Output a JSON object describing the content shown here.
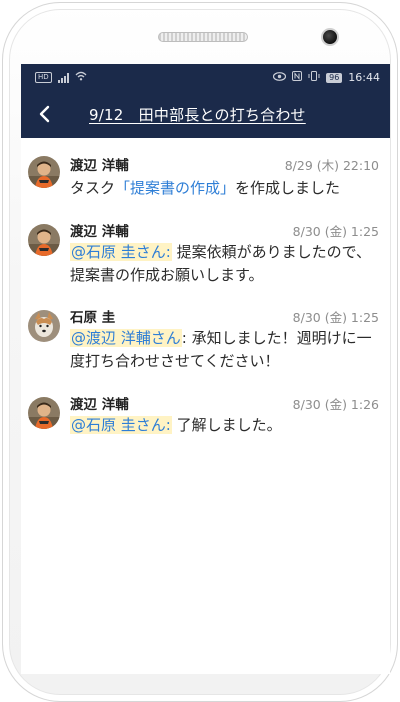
{
  "status_bar": {
    "time": "16:44",
    "battery": "96"
  },
  "header": {
    "title": "9/12　田中部長との打ち合わせ"
  },
  "messages": [
    {
      "sender": "渡辺 洋輔",
      "timestamp": "8/29 (木) 22:10",
      "body_pre": "タスク",
      "body_link": "「提案書の作成」",
      "body_post": "を作成しました"
    },
    {
      "sender": "渡辺 洋輔",
      "timestamp": "8/30 (金) 1:25",
      "mention": "@石原 圭さん:",
      "body": " 提案依頼がありましたので、提案書の作成お願いします。"
    },
    {
      "sender": "石原 圭",
      "timestamp": "8/30 (金) 1:25",
      "mention": "@渡辺 洋輔さん",
      "body": ": 承知しました！週明けに一度打ち合わせさせてください！"
    },
    {
      "sender": "渡辺 洋輔",
      "timestamp": "8/30 (金) 1:26",
      "mention": "@石原 圭さん:",
      "body": " 了解しました。"
    }
  ],
  "colors": {
    "navy": "#1b2a4a",
    "link": "#2e7ed6",
    "mention_bg": "#fff3c4"
  },
  "icons": [
    "back-icon",
    "hd-icon",
    "signal-icon",
    "wifi-icon",
    "eye-icon",
    "nfc-icon",
    "vibrate-icon",
    "battery-icon"
  ]
}
